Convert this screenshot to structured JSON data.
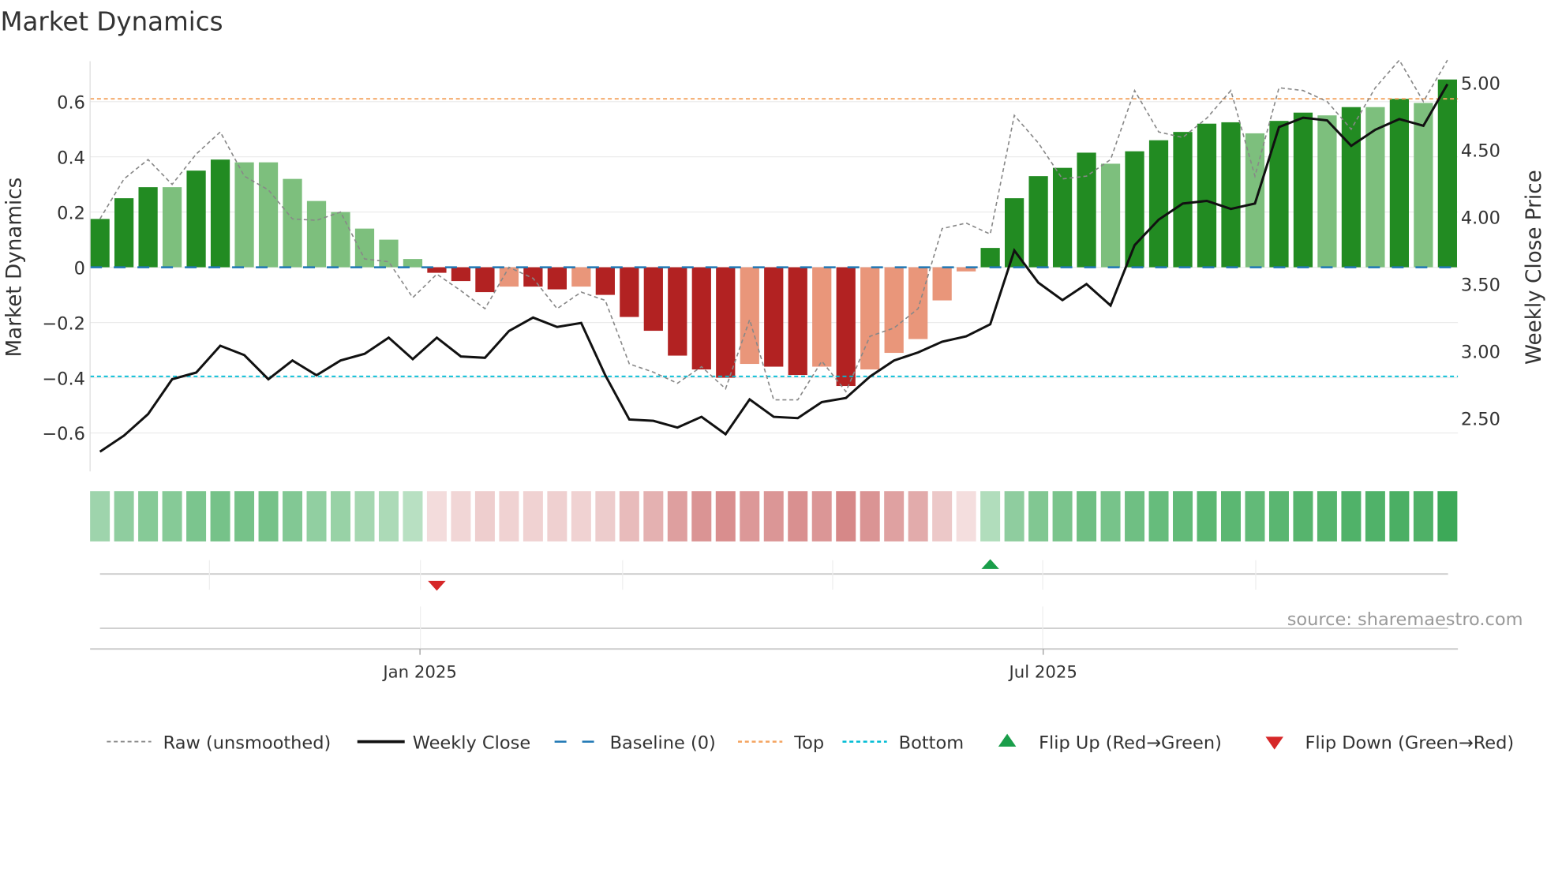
{
  "chart_data": {
    "type": "bar",
    "title": "Market Dynamics",
    "ylabel": "Market Dynamics",
    "y2label": "Weekly Close Price",
    "ylim": [
      -0.73,
      0.74
    ],
    "y2lim": [
      2.15,
      5.15
    ],
    "yticks": [
      "0.6",
      "0.4",
      "0.2",
      "0",
      "−0.2",
      "−0.4",
      "−0.6"
    ],
    "ytick_values": [
      0.6,
      0.4,
      0.2,
      0,
      -0.2,
      -0.4,
      -0.6
    ],
    "y2ticks": [
      "5.00",
      "4.50",
      "4.00",
      "3.50",
      "3.00",
      "2.50"
    ],
    "y2tick_values": [
      5.0,
      4.5,
      4.0,
      3.5,
      3.0,
      2.5
    ],
    "xticks": [
      {
        "label": "Jan 2025",
        "index": 13.3
      },
      {
        "label": "Jul 2025",
        "index": 39.2
      }
    ],
    "top_level": 0.61,
    "bottom_level": -0.395,
    "values": [
      0.175,
      0.25,
      0.29,
      0.29,
      0.35,
      0.39,
      0.38,
      0.38,
      0.32,
      0.24,
      0.2,
      0.14,
      0.1,
      0.03,
      -0.02,
      -0.05,
      -0.09,
      -0.07,
      -0.07,
      -0.08,
      -0.07,
      -0.1,
      -0.18,
      -0.23,
      -0.32,
      -0.37,
      -0.4,
      -0.35,
      -0.36,
      -0.39,
      -0.36,
      -0.43,
      -0.37,
      -0.31,
      -0.26,
      -0.12,
      -0.015,
      0.07,
      0.25,
      0.33,
      0.36,
      0.415,
      0.375,
      0.42,
      0.46,
      0.49,
      0.52,
      0.525,
      0.485,
      0.53,
      0.56,
      0.55,
      0.58,
      0.58,
      0.61,
      0.595,
      0.68
    ],
    "strong": [
      1,
      1,
      1,
      0,
      1,
      1,
      0,
      0,
      0,
      0,
      0,
      0,
      0,
      0,
      1,
      1,
      1,
      0,
      1,
      1,
      0,
      1,
      1,
      1,
      1,
      1,
      1,
      0,
      1,
      1,
      0,
      1,
      0,
      0,
      0,
      0,
      0,
      1,
      1,
      1,
      1,
      1,
      0,
      1,
      1,
      1,
      1,
      1,
      0,
      1,
      1,
      0,
      1,
      0,
      1,
      0,
      1
    ],
    "raw": [
      0.175,
      0.32,
      0.39,
      0.3,
      0.41,
      0.49,
      0.33,
      0.28,
      0.175,
      0.17,
      0.2,
      0.03,
      0.02,
      -0.11,
      -0.025,
      -0.085,
      -0.15,
      0.0,
      -0.04,
      -0.15,
      -0.09,
      -0.12,
      -0.35,
      -0.38,
      -0.42,
      -0.36,
      -0.44,
      -0.19,
      -0.48,
      -0.48,
      -0.34,
      -0.45,
      -0.25,
      -0.22,
      -0.15,
      0.14,
      0.16,
      0.12,
      0.55,
      0.45,
      0.32,
      0.33,
      0.39,
      0.64,
      0.49,
      0.47,
      0.54,
      0.64,
      0.33,
      0.65,
      0.64,
      0.6,
      0.5,
      0.65,
      0.75,
      0.6,
      0.75
    ],
    "close": [
      2.25,
      2.37,
      2.53,
      2.79,
      2.84,
      3.04,
      2.97,
      2.79,
      2.93,
      2.82,
      2.93,
      2.98,
      3.1,
      2.94,
      3.1,
      2.96,
      2.95,
      3.15,
      3.25,
      3.18,
      3.21,
      2.82,
      2.49,
      2.48,
      2.43,
      2.51,
      2.38,
      2.64,
      2.51,
      2.5,
      2.62,
      2.65,
      2.81,
      2.93,
      2.99,
      3.07,
      3.11,
      3.2,
      3.75,
      3.51,
      3.38,
      3.5,
      3.34,
      3.79,
      3.98,
      4.1,
      4.12,
      4.06,
      4.1,
      4.67,
      4.74,
      4.72,
      4.53,
      4.65,
      4.73,
      4.68,
      4.99
    ],
    "flip_down_index": [
      14
    ],
    "flip_up_index": [
      37
    ],
    "colors": {
      "green_strong": "#228b22",
      "green_light": "#7dbf7d",
      "red_strong": "#b22222",
      "red_light": "#e9967a",
      "top": "#f4a460",
      "bottom": "#00bcd4",
      "baseline": "#1f77b4",
      "flip_up": "#1a9e4a",
      "flip_down": "#d62728"
    },
    "legend": [
      "Raw (unsmoothed)",
      "Weekly Close",
      "Baseline (0)",
      "Top",
      "Bottom",
      "Flip Up (Red→Green)",
      "Flip Down (Green→Red)"
    ],
    "legend_position": "bottom"
  },
  "source": "source: sharemaestro.com"
}
